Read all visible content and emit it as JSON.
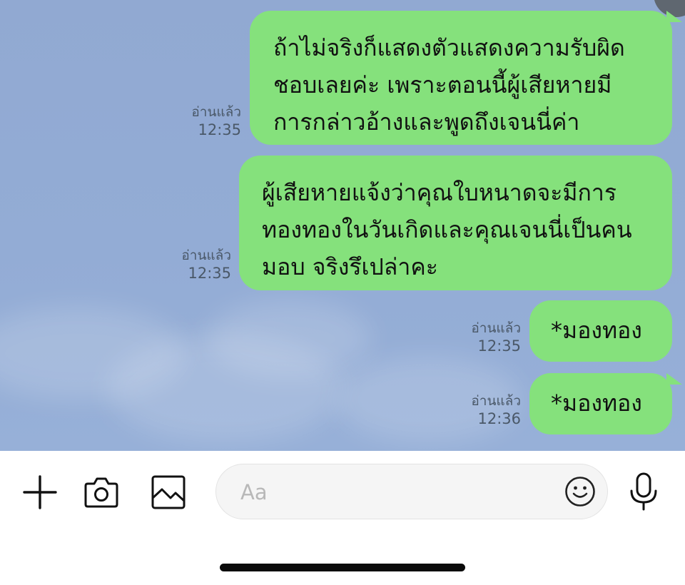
{
  "theme": {
    "bubble_color": "#85e17c",
    "chat_background": "#93acd5",
    "input_background": "#f5f5f5"
  },
  "messages": [
    {
      "lines": [
        "ถ้าไม่จริงก็แสดงตัวแสดงความรับผิด",
        "ชอบเลยค่ะ เพราะตอนนี้ผู้เสียหายมี",
        "การกล่าวอ้างและพูดถึงเจนนี่ค่า"
      ],
      "status": "อ่านแล้ว",
      "time": "12:35"
    },
    {
      "lines": [
        "ผู้เสียหายแจ้งว่าคุณใบหนาดจะมีการ",
        "ทองทองในวันเกิดและคุณเจนนี่เป็นคน",
        "มอบ จริงรึเปล่าคะ"
      ],
      "status": "อ่านแล้ว",
      "time": "12:35"
    },
    {
      "lines": [
        "*มองทอง"
      ],
      "status": "อ่านแล้ว",
      "time": "12:35"
    },
    {
      "lines": [
        "*มองทอง"
      ],
      "status": "อ่านแล้ว",
      "time": "12:36"
    }
  ],
  "input_bar": {
    "placeholder": "Aa",
    "icons": [
      "plus-icon",
      "camera-icon",
      "image-icon",
      "emoji-icon",
      "microphone-icon"
    ]
  }
}
